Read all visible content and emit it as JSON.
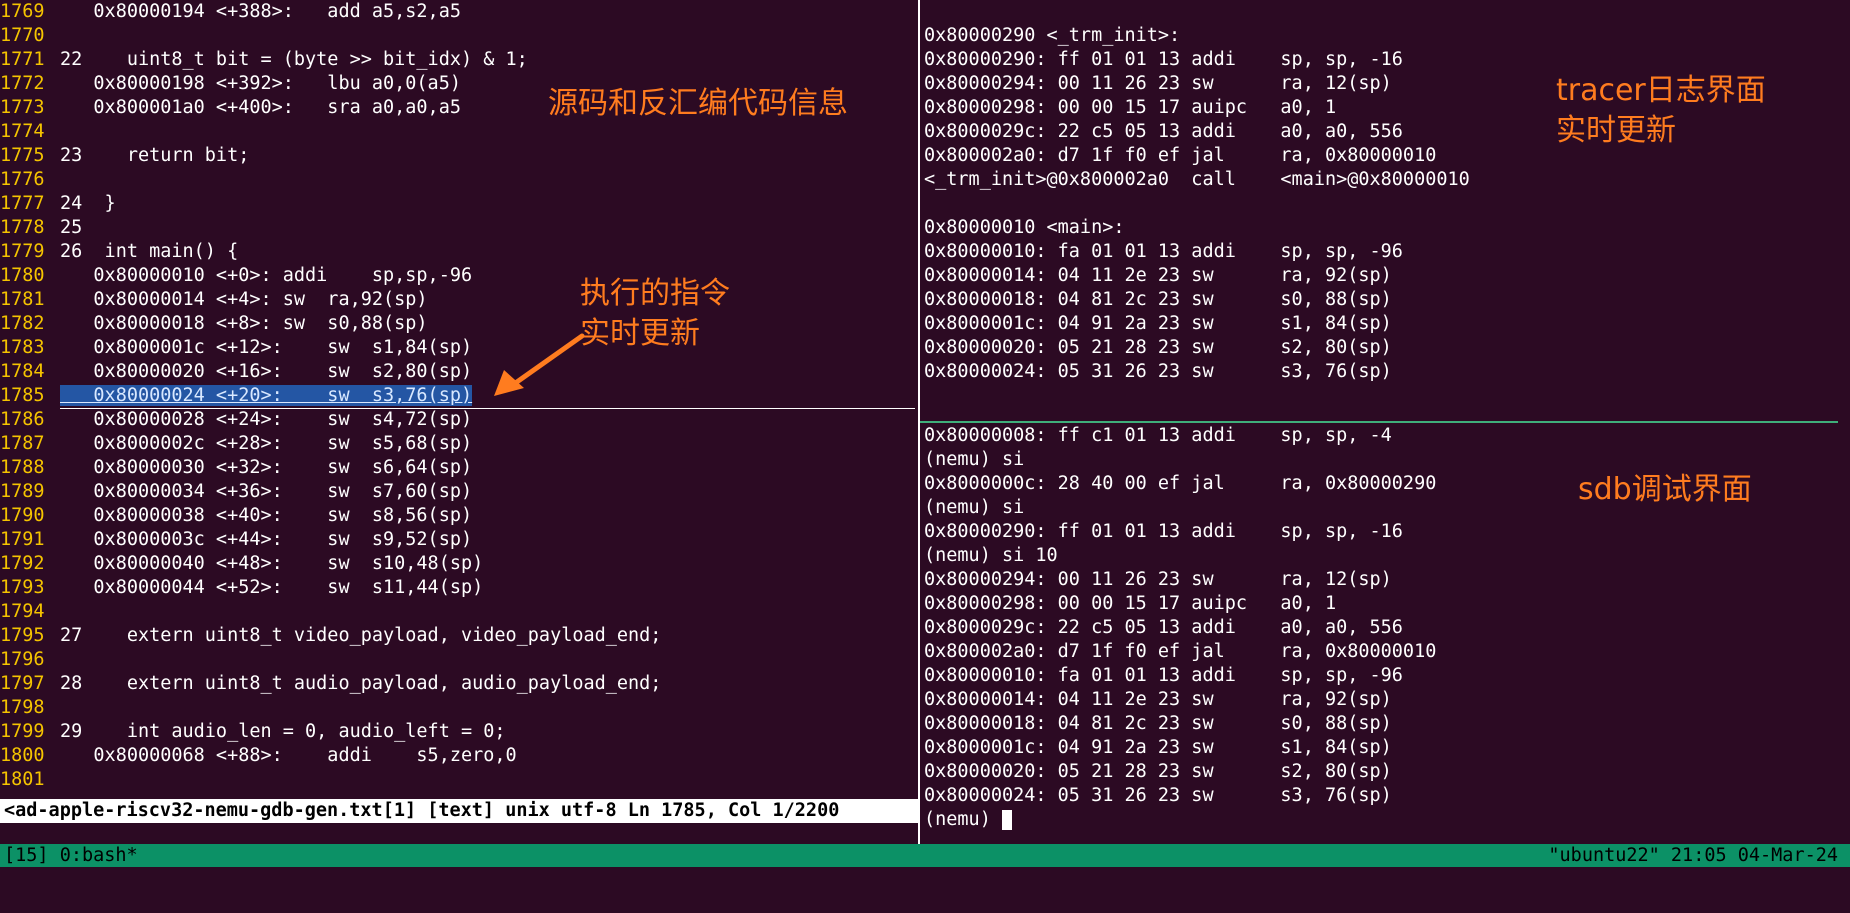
{
  "left_pane": {
    "lines": [
      {
        "n": "1769",
        "text": "   0x80000194 <+388>:   add a5,s2,a5"
      },
      {
        "n": "1770",
        "text": ""
      },
      {
        "n": "1771",
        "text": "22    uint8_t bit = (byte >> bit_idx) & 1;"
      },
      {
        "n": "1772",
        "text": "   0x80000198 <+392>:   lbu a0,0(a5)"
      },
      {
        "n": "1773",
        "text": "   0x800001a0 <+400>:   sra a0,a0,a5"
      },
      {
        "n": "1774",
        "text": ""
      },
      {
        "n": "1775",
        "text": "23    return bit;"
      },
      {
        "n": "1776",
        "text": ""
      },
      {
        "n": "1777",
        "text": "24  }"
      },
      {
        "n": "1778",
        "text": "25"
      },
      {
        "n": "1779",
        "text": "26  int main() {"
      },
      {
        "n": "1780",
        "text": "   0x80000010 <+0>: addi    sp,sp,-96"
      },
      {
        "n": "1781",
        "text": "   0x80000014 <+4>: sw  ra,92(sp)"
      },
      {
        "n": "1782",
        "text": "   0x80000018 <+8>: sw  s0,88(sp)"
      },
      {
        "n": "1783",
        "text": "   0x8000001c <+12>:    sw  s1,84(sp)"
      },
      {
        "n": "1784",
        "text": "   0x80000020 <+16>:    sw  s2,80(sp)"
      },
      {
        "n": "1785",
        "text": "   0x80000024 <+20>:    sw  s3,76(sp)",
        "highlight": true
      },
      {
        "n": "1786",
        "text": "   0x80000028 <+24>:    sw  s4,72(sp)"
      },
      {
        "n": "1787",
        "text": "   0x8000002c <+28>:    sw  s5,68(sp)"
      },
      {
        "n": "1788",
        "text": "   0x80000030 <+32>:    sw  s6,64(sp)"
      },
      {
        "n": "1789",
        "text": "   0x80000034 <+36>:    sw  s7,60(sp)"
      },
      {
        "n": "1790",
        "text": "   0x80000038 <+40>:    sw  s8,56(sp)"
      },
      {
        "n": "1791",
        "text": "   0x8000003c <+44>:    sw  s9,52(sp)"
      },
      {
        "n": "1792",
        "text": "   0x80000040 <+48>:    sw  s10,48(sp)"
      },
      {
        "n": "1793",
        "text": "   0x80000044 <+52>:    sw  s11,44(sp)"
      },
      {
        "n": "1794",
        "text": ""
      },
      {
        "n": "1795",
        "text": "27    extern uint8_t video_payload, video_payload_end;"
      },
      {
        "n": "1796",
        "text": ""
      },
      {
        "n": "1797",
        "text": "28    extern uint8_t audio_payload, audio_payload_end;"
      },
      {
        "n": "1798",
        "text": ""
      },
      {
        "n": "1799",
        "text": "29    int audio_len = 0, audio_left = 0;"
      },
      {
        "n": "1800",
        "text": "   0x80000068 <+88>:    addi    s5,zero,0"
      },
      {
        "n": "1801",
        "text": ""
      }
    ],
    "status": "<ad-apple-riscv32-nemu-gdb-gen.txt[1] [text] unix utf-8 Ln 1785, Col 1/2200"
  },
  "tracer_pane": {
    "lines": [
      "",
      "0x80000290 <_trm_init>:",
      "0x80000290: ff 01 01 13 addi    sp, sp, -16",
      "0x80000294: 00 11 26 23 sw      ra, 12(sp)",
      "0x80000298: 00 00 15 17 auipc   a0, 1",
      "0x8000029c: 22 c5 05 13 addi    a0, a0, 556",
      "0x800002a0: d7 1f f0 ef jal     ra, 0x80000010",
      "<_trm_init>@0x800002a0  call    <main>@0x80000010",
      "",
      "0x80000010 <main>:",
      "0x80000010: fa 01 01 13 addi    sp, sp, -96",
      "0x80000014: 04 11 2e 23 sw      ra, 92(sp)",
      "0x80000018: 04 81 2c 23 sw      s0, 88(sp)",
      "0x8000001c: 04 91 2a 23 sw      s1, 84(sp)",
      "0x80000020: 05 21 28 23 sw      s2, 80(sp)",
      "0x80000024: 05 31 26 23 sw      s3, 76(sp)"
    ]
  },
  "sdb_pane": {
    "lines": [
      "0x80000008: ff c1 01 13 addi    sp, sp, -4",
      "(nemu) si",
      "0x8000000c: 28 40 00 ef jal     ra, 0x80000290",
      "(nemu) si",
      "0x80000290: ff 01 01 13 addi    sp, sp, -16",
      "(nemu) si 10",
      "0x80000294: 00 11 26 23 sw      ra, 12(sp)",
      "0x80000298: 00 00 15 17 auipc   a0, 1",
      "0x8000029c: 22 c5 05 13 addi    a0, a0, 556",
      "0x800002a0: d7 1f f0 ef jal     ra, 0x80000010",
      "0x80000010: fa 01 01 13 addi    sp, sp, -96",
      "0x80000014: 04 11 2e 23 sw      ra, 92(sp)",
      "0x80000018: 04 81 2c 23 sw      s0, 88(sp)",
      "0x8000001c: 04 91 2a 23 sw      s1, 84(sp)",
      "0x80000020: 05 21 28 23 sw      s2, 80(sp)",
      "0x80000024: 05 31 26 23 sw      s3, 76(sp)"
    ],
    "prompt": "(nemu) "
  },
  "annotations": {
    "source": "源码和反汇编代码信息",
    "exec_line1": "执行的指令",
    "exec_line2": "实时更新",
    "tracer_line1": "tracer日志界面",
    "tracer_line2": "实时更新",
    "sdb": "sdb调试界面"
  },
  "tmux": {
    "left": "[15] 0:bash*",
    "right": "\"ubuntu22\" 21:05 04-Mar-24"
  },
  "colors": {
    "background": "#2c0a23",
    "line_number": "#f5c400",
    "highlight": "#2456a4",
    "annotation": "#ff7c1f",
    "tmux_bar": "#0c9166",
    "divider": "#3fae7a"
  }
}
